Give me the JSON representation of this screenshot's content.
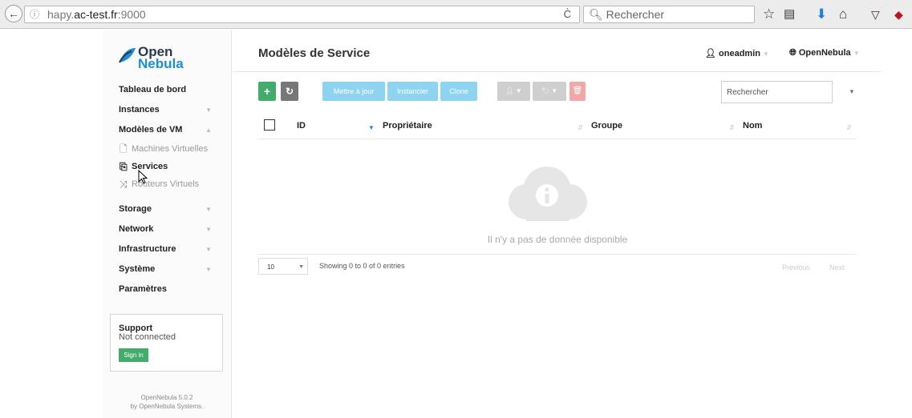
{
  "browser": {
    "url_host_prefix": "hapy.",
    "url_host_bold": "ac-test.fr",
    "url_port": ":9000",
    "search_placeholder": "Rechercher"
  },
  "sidebar": {
    "logo_line1": "Open",
    "logo_line2": "Nebula",
    "items": [
      {
        "label": "Tableau de bord"
      },
      {
        "label": "Instances"
      },
      {
        "label": "Modèles de VM"
      },
      {
        "label": "Machines Virtuelles"
      },
      {
        "label": "Services"
      },
      {
        "label": "Routeurs Virtuels"
      },
      {
        "label": "Storage"
      },
      {
        "label": "Network"
      },
      {
        "label": "Infrastructure"
      },
      {
        "label": "Système"
      },
      {
        "label": "Paramètres"
      }
    ],
    "support_title": "Support",
    "support_status": "Not connected",
    "signin_label": "Sign in",
    "footer_line1": "OpenNebula 5.0.2",
    "footer_line2": "by OpenNebula Systems."
  },
  "header": {
    "title": "Modèles de Service",
    "user": "oneadmin",
    "zone": "OpenNebula"
  },
  "toolbar": {
    "add_label": "+",
    "refresh_label": "↻",
    "update_label": "Mettre à jour",
    "instantiate_label": "Instancier",
    "clone_label": "Clone",
    "search_placeholder": "Rechercher"
  },
  "table": {
    "columns": [
      "ID",
      "Propriétaire",
      "Groupe",
      "Nom"
    ],
    "empty_message": "Il n'y a pas de donnée disponible",
    "page_size": "10",
    "showing": "Showing 0 to 0 of 0 entries",
    "previous": "Previous",
    "next": "Next"
  },
  "colors": {
    "green": "#43ac6a",
    "gray_button": "#777777",
    "light_blue": "#8ed3ef",
    "light_gray": "#cfcfcf",
    "light_red": "#f0a9a9",
    "brand_blue": "#1c8ed6"
  }
}
